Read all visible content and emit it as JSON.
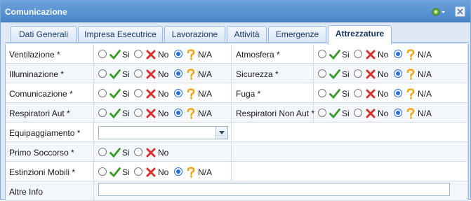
{
  "window": {
    "title": "Comunicazione"
  },
  "tabs": [
    {
      "label": "Dati Generali"
    },
    {
      "label": "Impresa Esecutrice"
    },
    {
      "label": "Lavorazione"
    },
    {
      "label": "Attività"
    },
    {
      "label": "Emergenze"
    },
    {
      "label": "Attrezzature"
    }
  ],
  "active_tab": "Attrezzature",
  "options": {
    "si": "Si",
    "no": "No",
    "na": "N/A"
  },
  "rows": [
    {
      "left_label": "Ventilazione *",
      "left_value": "N/A",
      "right_label": "Atmosfera *",
      "right_value": "N/A"
    },
    {
      "left_label": "Illuminazione *",
      "left_value": "N/A",
      "right_label": "Sicurezza *",
      "right_value": "N/A"
    },
    {
      "left_label": "Comunicazione *",
      "left_value": "N/A",
      "right_label": "Fuga *",
      "right_value": "N/A"
    },
    {
      "left_label": "Respiratori Aut *",
      "left_value": "N/A",
      "right_label": "Respiratori Non Aut *",
      "right_value": "N/A"
    }
  ],
  "equipaggiamento": {
    "label": "Equipaggiamento *",
    "value": ""
  },
  "primo_soccorso": {
    "label": "Primo Soccorso *",
    "value": ""
  },
  "estinzioni": {
    "label": "Estinzioni Mobili *",
    "value": "N/A"
  },
  "altre_info": {
    "label": "Altre Info",
    "value": ""
  },
  "colors": {
    "titlebar": "#5b95d4",
    "tab_border": "#99bbe8",
    "check": "#3a9b2a",
    "cross": "#d9302b",
    "question": "#f0a818",
    "radio_selected": "#2a6fd6"
  }
}
